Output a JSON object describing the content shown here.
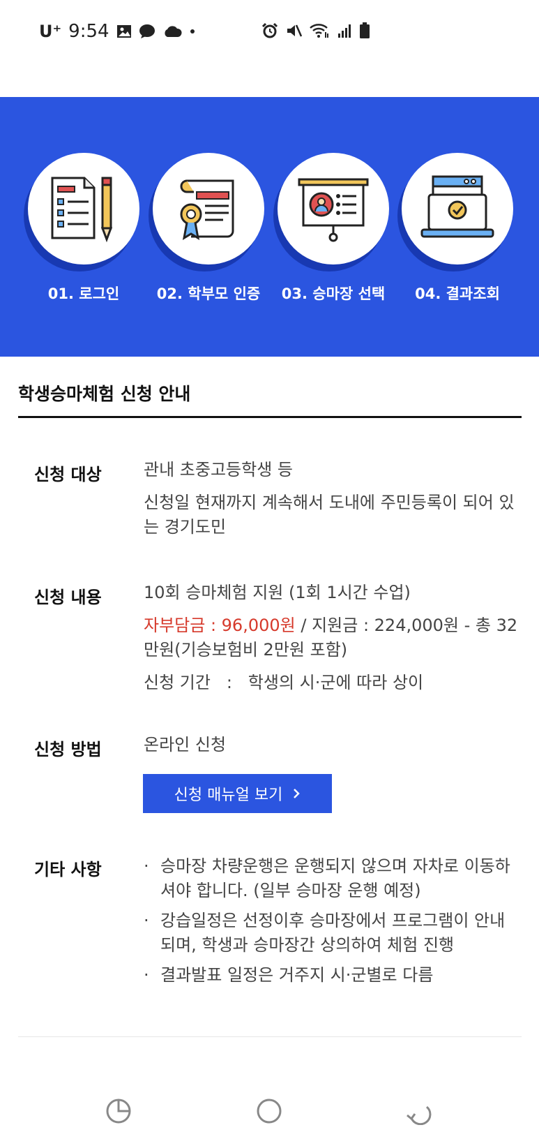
{
  "status_bar": {
    "carrier": "U⁺",
    "time": "9:54",
    "left_icons": [
      "gallery-icon",
      "chat-bubble-icon",
      "cloud-icon",
      "dot-icon"
    ],
    "right_icons": [
      "alarm-icon",
      "mute-icon",
      "wifi-icon",
      "signal-icon",
      "battery-icon"
    ]
  },
  "steps": [
    {
      "label": "01. 로그인",
      "icon": "document-checklist-icon"
    },
    {
      "label": "02. 학부모 인증",
      "icon": "certificate-icon"
    },
    {
      "label": "03. 승마장 선택",
      "icon": "presentation-board-icon"
    },
    {
      "label": "04. 결과조회",
      "icon": "laptop-check-icon"
    }
  ],
  "section_title": "학생승마체험 신청 안내",
  "target": {
    "label": "신청 대상",
    "line1": "관내 초중고등학생 등",
    "line2": "신청일 현재까지 계속해서 도내에 주민등록이 되어 있는 경기도민"
  },
  "content": {
    "label": "신청 내용",
    "line1": "10회 승마체험 지원 (1회 1시간 수업)",
    "self_pay": "자부담금 : 96,000원",
    "support": " / 지원금 : 224,000원 - 총 32만원(기승보험비 2만원 포함)",
    "period": "신청 기간   :   학생의 시·군에 따라 상이"
  },
  "method": {
    "label": "신청 방법",
    "value": "온라인 신청",
    "button": "신청 매뉴얼 보기"
  },
  "etc": {
    "label": "기타 사항",
    "items": [
      "승마장 차량운행은 운행되지 않으며 자차로 이동하셔야 합니다. (일부 승마장 운행 예정)",
      "강습일정은 선정이후 승마장에서 프로그램이 안내되며, 학생과 승마장간 상의하여 체험 진행",
      "결과발표 일정은 거주지 시·군별로 다름"
    ]
  },
  "colors": {
    "accent": "#2b55e0",
    "highlight": "#d6392b"
  },
  "nav_icons": [
    "recent-apps-icon",
    "home-icon",
    "back-icon"
  ]
}
